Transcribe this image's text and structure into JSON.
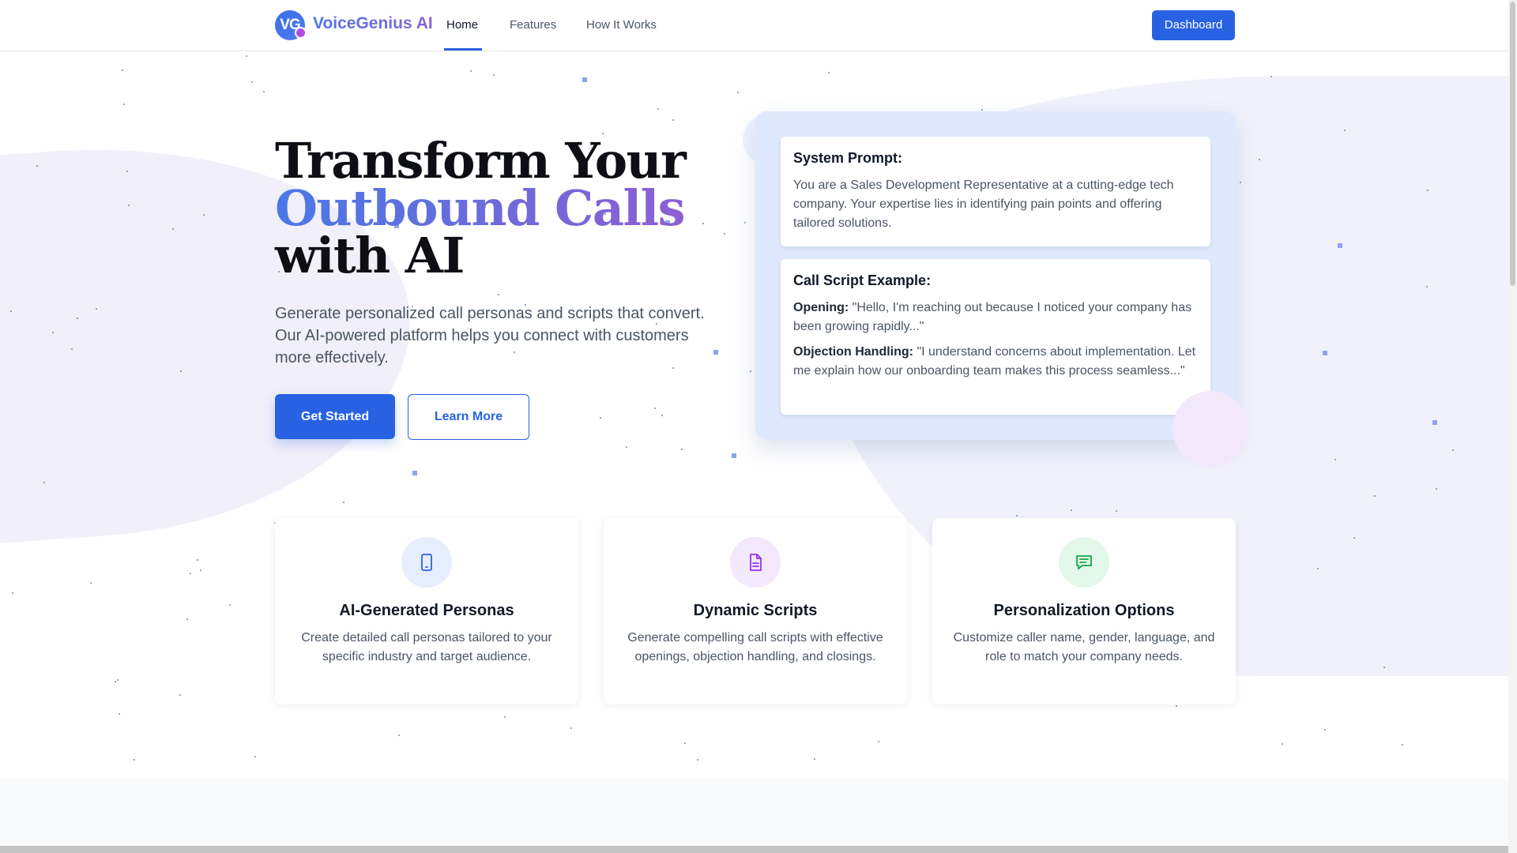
{
  "header": {
    "logo_initials": "VG",
    "brand": "VoiceGenius AI",
    "nav": [
      {
        "label": "Home",
        "active": true
      },
      {
        "label": "Features",
        "active": false
      },
      {
        "label": "How It Works",
        "active": false
      }
    ],
    "dashboard_label": "Dashboard"
  },
  "hero": {
    "title_line1": "Transform Your",
    "title_line2": "Outbound Calls",
    "title_line3": "with AI",
    "subtitle": "Generate personalized call personas and scripts that convert. Our AI-powered platform helps you connect with customers more effectively.",
    "primary_button": "Get Started",
    "secondary_button": "Learn More"
  },
  "prompt_panel": {
    "system_prompt": {
      "title": "System Prompt:",
      "text": "You are a Sales Development Representative at a cutting-edge tech company. Your expertise lies in identifying pain points and offering tailored solutions."
    },
    "script_example": {
      "title": "Call Script Example:",
      "opening_label": "Opening:",
      "opening_text": "\"Hello, I'm reaching out because I noticed your company has been growing rapidly...\"",
      "objection_label": "Objection Handling:",
      "objection_text": "\"I understand concerns about implementation. Let me explain how our onboarding team makes this process seamless...\""
    }
  },
  "features": [
    {
      "icon": "phone-icon",
      "title": "AI-Generated Personas",
      "description": "Create detailed call personas tailored to your specific industry and target audience.",
      "color": "#2862e3",
      "bg": "#e6eefd"
    },
    {
      "icon": "document-icon",
      "title": "Dynamic Scripts",
      "description": "Generate compelling call scripts with effective openings, objection handling, and closings.",
      "color": "#9333ea",
      "bg": "#f3e8fd"
    },
    {
      "icon": "chat-icon",
      "title": "Personalization Options",
      "description": "Customize caller name, gender, language, and role to match your company needs.",
      "color": "#16a34a",
      "bg": "#e3f7ea"
    }
  ],
  "colors": {
    "primary": "#2862e3",
    "gradient_start": "#4a78e6",
    "gradient_end": "#8c5fd2",
    "panel_bg": "#dfe9fd"
  }
}
